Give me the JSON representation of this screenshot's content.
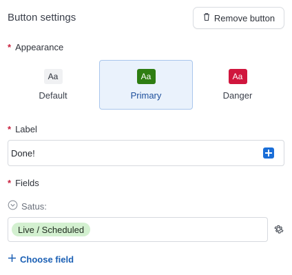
{
  "header": {
    "title": "Button settings",
    "remove_label": "Remove button"
  },
  "appearance": {
    "label": "Appearance",
    "required_mark": "*",
    "options": [
      {
        "swatch": "Aa",
        "name": "Default",
        "bg": "#f0f1f3",
        "fg": "#2b2f38",
        "selected": false
      },
      {
        "swatch": "Aa",
        "name": "Primary",
        "bg": "#2e7d12",
        "fg": "#ffffff",
        "selected": true
      },
      {
        "swatch": "Aa",
        "name": "Danger",
        "bg": "#d0163d",
        "fg": "#ffffff",
        "selected": false
      }
    ]
  },
  "label_field": {
    "label": "Label",
    "required_mark": "*",
    "value": "Done!"
  },
  "fields": {
    "label": "Fields",
    "required_mark": "*",
    "status_label": "Satus:",
    "tag": "Live / Scheduled",
    "choose_label": "Choose field"
  },
  "colors": {
    "accent": "#1a6ed8",
    "required": "#c81e3c",
    "tag_bg": "#d3f0d0"
  }
}
